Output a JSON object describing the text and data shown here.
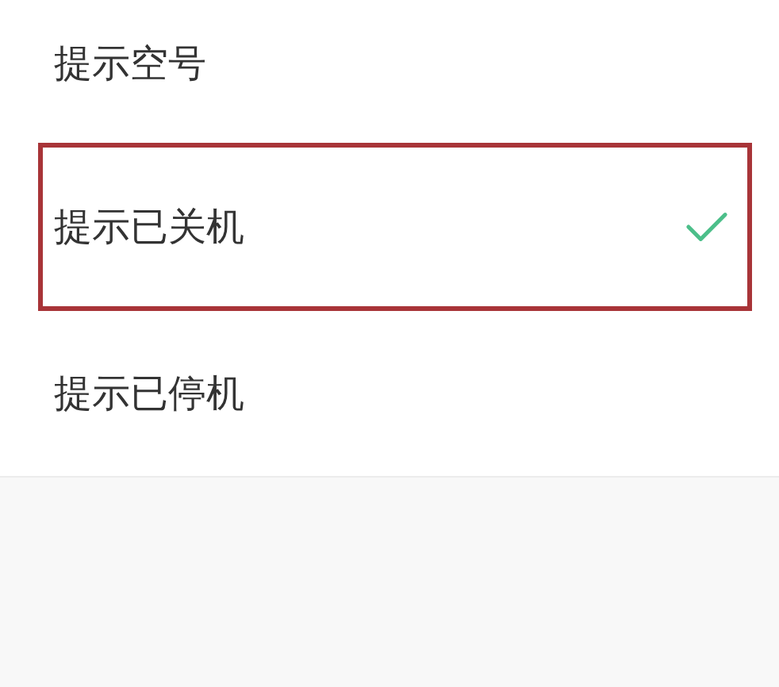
{
  "options": [
    {
      "label": "提示空号",
      "selected": false,
      "highlighted": false
    },
    {
      "label": "提示已关机",
      "selected": true,
      "highlighted": true
    },
    {
      "label": "提示已停机",
      "selected": false,
      "highlighted": false
    }
  ]
}
